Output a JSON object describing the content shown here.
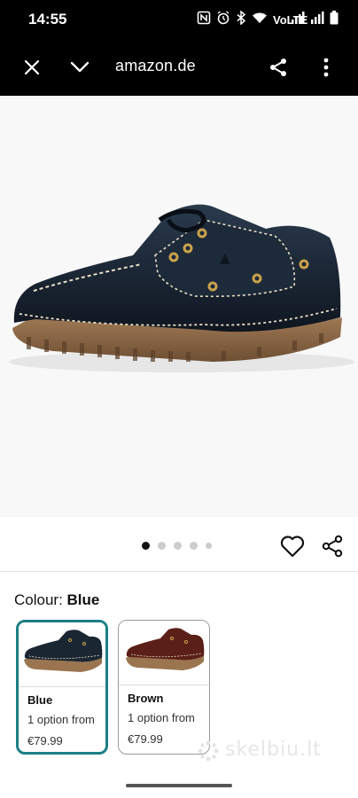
{
  "status_bar": {
    "time": "14:55",
    "icons": [
      "nfc-icon",
      "alarm-icon",
      "bluetooth-icon",
      "wifi-icon",
      "volte-icon",
      "signal-icon",
      "signal-icon",
      "battery-icon"
    ],
    "volte_text": "VoLTE"
  },
  "toolbar": {
    "url": "amazon.de",
    "close_icon": "close-icon",
    "collapse_icon": "chevron-down-icon",
    "share_icon": "share-icon",
    "more_icon": "more-vert-icon"
  },
  "gallery": {
    "image": "black-boat-shoe",
    "dots_count": 5,
    "active_dot": 1
  },
  "actions": {
    "favorite_icon": "heart-icon",
    "share_icon": "share-icon"
  },
  "colour": {
    "label": "Colour: ",
    "selected_value": "Blue",
    "swatches": [
      {
        "name": "Blue",
        "options": "1 option from",
        "price": "€79.99",
        "selected": true,
        "color": "#1b2633"
      },
      {
        "name": "Brown",
        "options": "1 option from",
        "price": "€79.99",
        "selected": false,
        "color": "#5a1f17"
      }
    ]
  },
  "watermark": "skelbiu.lt",
  "colors": {
    "accent": "#1c7f86",
    "background": "#000000",
    "image_bg": "#f8f8f8"
  }
}
